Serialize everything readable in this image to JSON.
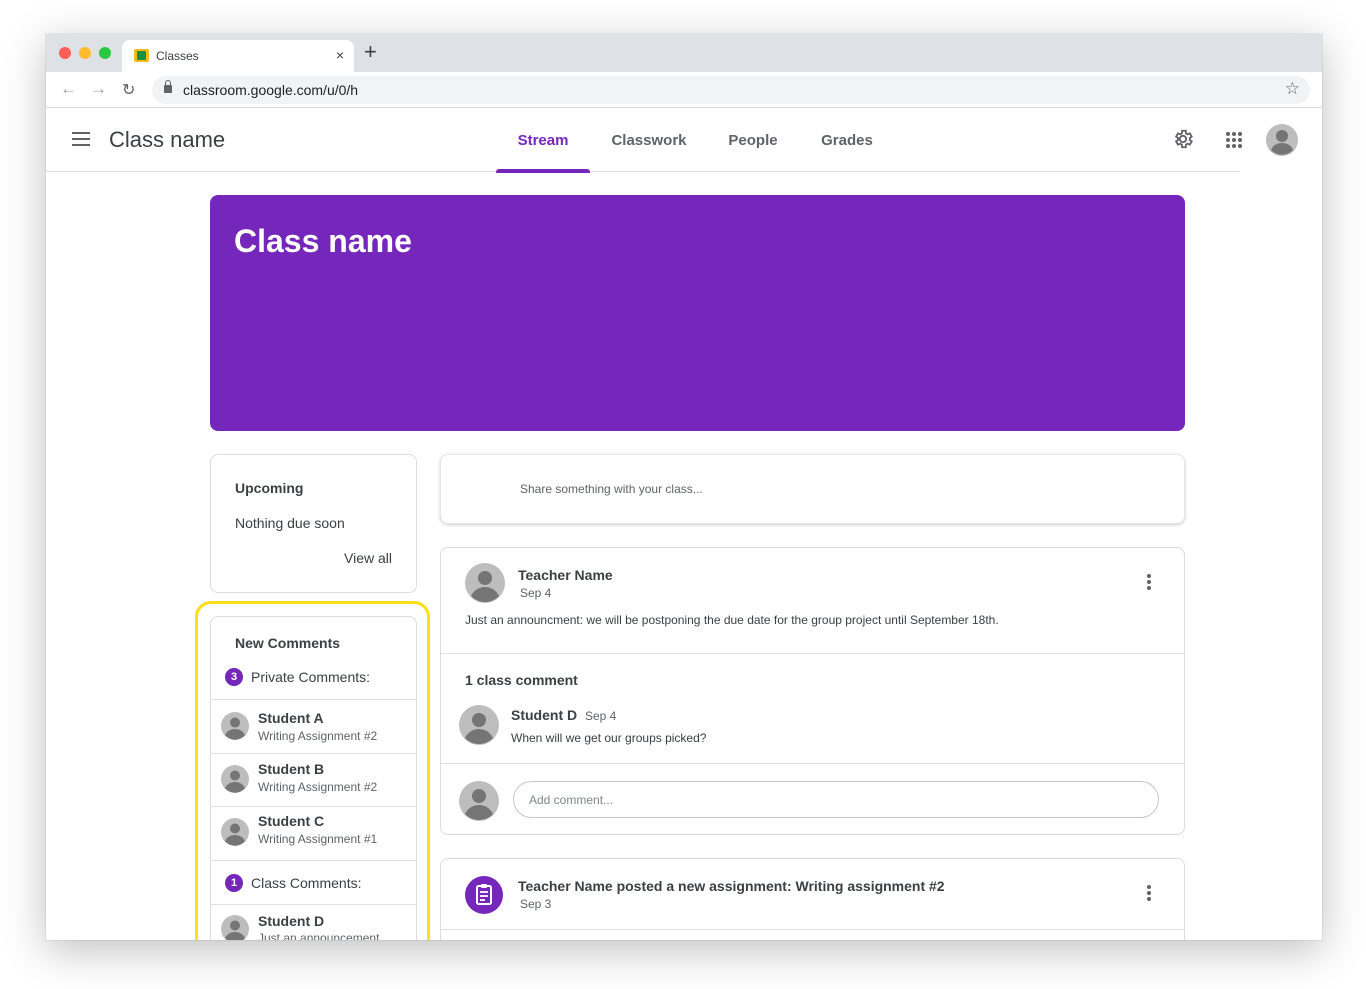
{
  "browser": {
    "tab_title": "Classes",
    "tab_close": "×",
    "new_tab": "+",
    "url": "classroom.google.com/u/0/h",
    "back_icon": "arrow-left-icon",
    "forward_icon": "arrow-right-icon",
    "reload_icon": "reload-icon",
    "star_icon": "star-icon"
  },
  "header": {
    "title": "Class name",
    "tabs": [
      {
        "label": "Stream",
        "active": true
      },
      {
        "label": "Classwork",
        "active": false
      },
      {
        "label": "People",
        "active": false
      },
      {
        "label": "Grades",
        "active": false
      }
    ]
  },
  "banner": {
    "title": "Class name",
    "color": "#7627bb"
  },
  "upcoming": {
    "title": "Upcoming",
    "text": "Nothing due soon",
    "view_all": "View all"
  },
  "new_comments": {
    "title": "New Comments",
    "private_count": "3",
    "private_label": "Private Comments:",
    "private_items": [
      {
        "name": "Student A",
        "sub": "Writing Assignment #2"
      },
      {
        "name": "Student B",
        "sub": "Writing Assignment #2"
      },
      {
        "name": "Student C",
        "sub": "Writing Assignment #1"
      }
    ],
    "class_count": "1",
    "class_label": "Class Comments:",
    "class_items": [
      {
        "name": "Student D",
        "sub": "Just an announcement..."
      }
    ],
    "highlight_color": "#fedd1a"
  },
  "share": {
    "placeholder": "Share something with your class..."
  },
  "announcement": {
    "author": "Teacher Name",
    "date": "Sep 4",
    "text": "Just an announcment: we will be postponing the due date for the group project until September 18th.",
    "comment_count": "1 class comment",
    "comment": {
      "author": "Student D",
      "date": "Sep 4",
      "text": "When will we get our groups picked?"
    },
    "add_comment_placeholder": "Add comment..."
  },
  "assignment": {
    "title": "Teacher Name posted a new assignment: Writing assignment #2",
    "date": "Sep 3",
    "icon": "assignment-icon"
  },
  "colors": {
    "accent": "#7627bb",
    "highlight": "#fedd1a"
  }
}
